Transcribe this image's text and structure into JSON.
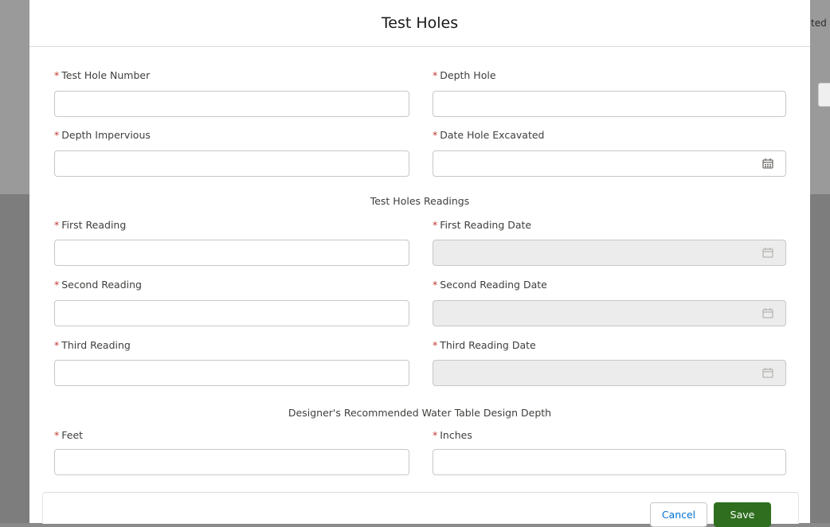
{
  "background": {
    "partial_text": "ted"
  },
  "modal": {
    "title": "Test Holes"
  },
  "fields": {
    "test_hole_number": {
      "label": "Test Hole Number",
      "value": ""
    },
    "depth_hole": {
      "label": "Depth Hole",
      "value": ""
    },
    "depth_impervious": {
      "label": "Depth Impervious",
      "value": ""
    },
    "date_hole_excavated": {
      "label": "Date Hole Excavated",
      "value": ""
    },
    "first_reading": {
      "label": "First Reading",
      "value": ""
    },
    "first_reading_date": {
      "label": "First Reading Date",
      "value": ""
    },
    "second_reading": {
      "label": "Second Reading",
      "value": ""
    },
    "second_reading_date": {
      "label": "Second Reading Date",
      "value": ""
    },
    "third_reading": {
      "label": "Third Reading",
      "value": ""
    },
    "third_reading_date": {
      "label": "Third Reading Date",
      "value": ""
    },
    "feet": {
      "label": "Feet",
      "value": ""
    },
    "inches": {
      "label": "Inches",
      "value": ""
    }
  },
  "sections": {
    "readings": "Test Holes Readings",
    "design_depth": "Designer's Recommended Water Table Design Depth"
  },
  "required_marker": "*",
  "footer": {
    "cancel_label": "Cancel",
    "save_label": "Save"
  },
  "colors": {
    "save_button": "#2e6e1e",
    "required": "#c23934",
    "cancel_text": "#0070d2"
  },
  "icons": {
    "date_picker": "calendar-icon"
  }
}
